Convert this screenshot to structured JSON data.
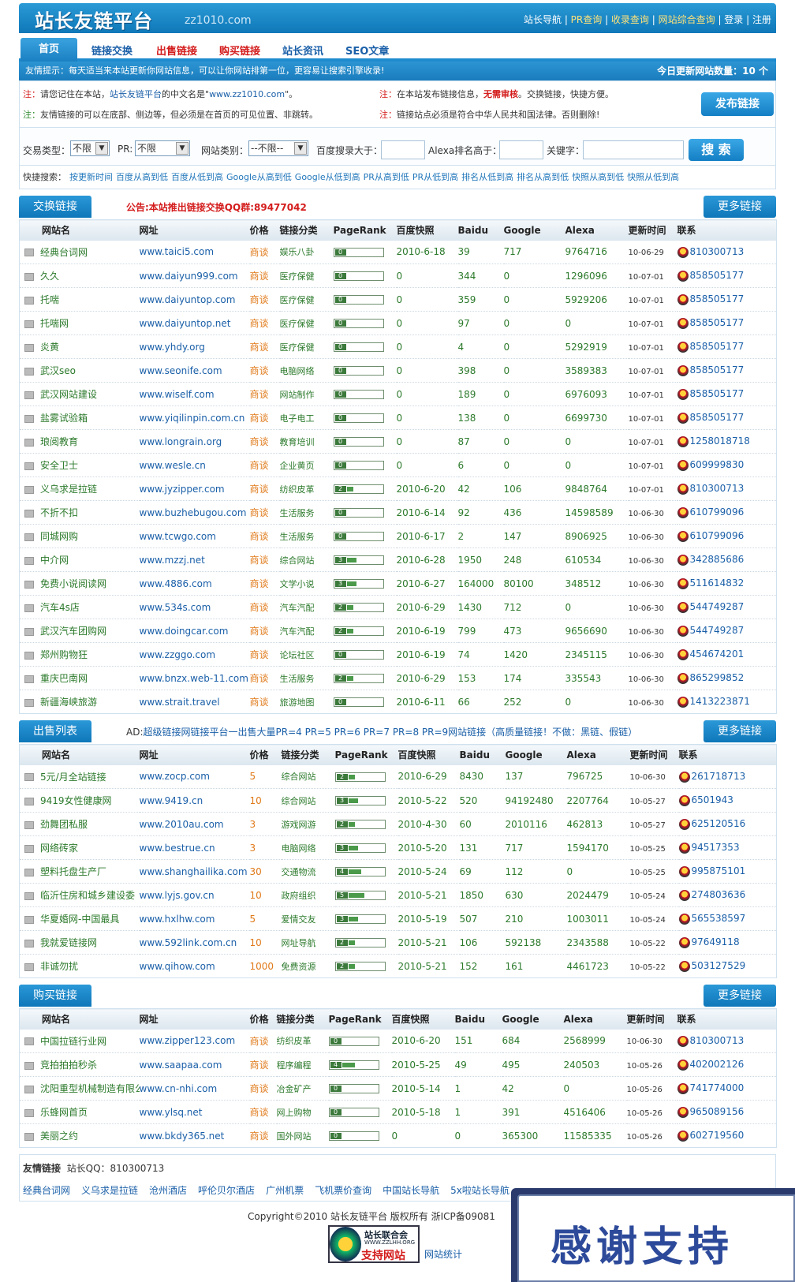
{
  "header": {
    "logo": "站长友链平台",
    "domain": "zz1010.com"
  },
  "toplinks": [
    "站长导航",
    "PR查询",
    "收录查询",
    "网站综合查询",
    "登录",
    "注册"
  ],
  "nav": [
    "首页",
    "链接交换",
    "出售链接",
    "购买链接",
    "站长资讯",
    "SEO文章"
  ],
  "tip": {
    "left": "友情提示：每天适当来本站更新你网站信息，可以让你网站排第一位，更容易让搜索引擎收录!",
    "right": "今日更新网站数量：10 个"
  },
  "notice": {
    "n1a": "注：",
    "n1b": "请您记住在本站，",
    "n1c": "站长友链平台",
    "n1d": "的中文名是\"",
    "n1e": "www.zz1010.com",
    "n1f": "\"。",
    "n2a": "注：",
    "n2b": "友情链接的可以在底部、侧边等，但必须是在首页的可见位置、非跳转。",
    "n3a": "注：",
    "n3b": "在本站发布链接信息，",
    "n3c": "无需审核",
    "n3d": "。交换链接，快捷方便。",
    "n4a": "注：",
    "n4b": "链接站点必须是符合中华人民共和国法律。否则删除!",
    "publish": "发布链接"
  },
  "search": {
    "type_label": "交易类型：",
    "type_val": "不限",
    "pr_label": "PR:",
    "pr_val": "不限",
    "cat_label": "网站类别：",
    "cat_val": "--不限--",
    "baidu_label": "百度搜录大于：",
    "alexa_label": "Alexa排名高于：",
    "kw_label": "关键字：",
    "btn": "搜 索"
  },
  "quick": {
    "label": "快捷搜索：",
    "links": [
      "按更新时间",
      "百度从高到低",
      "百度从低到高",
      "Google从高到低",
      "Google从低到高",
      "PR从高到低",
      "PR从低到高",
      "排名从低到高",
      "排名从高到低",
      "快照从高到低",
      "快照从低到高"
    ]
  },
  "cols": {
    "name": "网站名",
    "url": "网址",
    "price": "价格",
    "cat": "链接分类",
    "pr": "PageRank",
    "snap": "百度快照",
    "baidu": "Baidu",
    "google": "Google",
    "alexa": "Alexa",
    "time": "更新时间",
    "contact": "联系"
  },
  "exchange": {
    "title": "交换链接",
    "note": "公告:本站推出链接交换QQ群:89477042",
    "more": "更多链接",
    "rows": [
      {
        "name": "经典台词网",
        "url": "www.taici5.com",
        "price": "商谈",
        "cat": "娱乐八卦",
        "pr": "0",
        "snap": "2010-6-18",
        "baidu": "39",
        "google": "717",
        "alexa": "9764716",
        "time": "10-06-29",
        "qq": "810300713"
      },
      {
        "name": "久久",
        "url": "www.daiyun999.com",
        "price": "商谈",
        "cat": "医疗保健",
        "pr": "0",
        "snap": "0",
        "baidu": "344",
        "google": "0",
        "alexa": "1296096",
        "time": "10-07-01",
        "qq": "858505177"
      },
      {
        "name": "托喘",
        "url": "www.daiyuntop.com",
        "price": "商谈",
        "cat": "医疗保健",
        "pr": "0",
        "snap": "0",
        "baidu": "359",
        "google": "0",
        "alexa": "5929206",
        "time": "10-07-01",
        "qq": "858505177"
      },
      {
        "name": "托喘网",
        "url": "www.daiyuntop.net",
        "price": "商谈",
        "cat": "医疗保健",
        "pr": "0",
        "snap": "0",
        "baidu": "97",
        "google": "0",
        "alexa": "0",
        "time": "10-07-01",
        "qq": "858505177"
      },
      {
        "name": "炎黄",
        "url": "www.yhdy.org",
        "price": "商谈",
        "cat": "医疗保健",
        "pr": "0",
        "snap": "0",
        "baidu": "4",
        "google": "0",
        "alexa": "5292919",
        "time": "10-07-01",
        "qq": "858505177"
      },
      {
        "name": "武汉seo",
        "url": "www.seonife.com",
        "price": "商谈",
        "cat": "电脑网络",
        "pr": "0",
        "snap": "0",
        "baidu": "398",
        "google": "0",
        "alexa": "3589383",
        "time": "10-07-01",
        "qq": "858505177"
      },
      {
        "name": "武汉网站建设",
        "url": "www.wiself.com",
        "price": "商谈",
        "cat": "网站制作",
        "pr": "0",
        "snap": "0",
        "baidu": "189",
        "google": "0",
        "alexa": "6976093",
        "time": "10-07-01",
        "qq": "858505177"
      },
      {
        "name": "盐雾试验箱",
        "url": "www.yiqilinpin.com.cn",
        "price": "商谈",
        "cat": "电子电工",
        "pr": "0",
        "snap": "0",
        "baidu": "138",
        "google": "0",
        "alexa": "6699730",
        "time": "10-07-01",
        "qq": "858505177"
      },
      {
        "name": "琅阅教育",
        "url": "www.longrain.org",
        "price": "商谈",
        "cat": "教育培训",
        "pr": "0",
        "snap": "0",
        "baidu": "87",
        "google": "0",
        "alexa": "0",
        "time": "10-07-01",
        "qq": "1258018718"
      },
      {
        "name": "安全卫士",
        "url": "www.wesle.cn",
        "price": "商谈",
        "cat": "企业黄页",
        "pr": "0",
        "snap": "0",
        "baidu": "6",
        "google": "0",
        "alexa": "0",
        "time": "10-07-01",
        "qq": "609999830"
      },
      {
        "name": "义乌求是拉链",
        "url": "www.jyzipper.com",
        "price": "商谈",
        "cat": "纺织皮革",
        "pr": "2",
        "snap": "2010-6-20",
        "baidu": "42",
        "google": "106",
        "alexa": "9848764",
        "time": "10-07-01",
        "qq": "810300713"
      },
      {
        "name": "不折不扣",
        "url": "www.buzhebugou.com",
        "price": "商谈",
        "cat": "生活服务",
        "pr": "0",
        "snap": "2010-6-14",
        "baidu": "92",
        "google": "436",
        "alexa": "14598589",
        "time": "10-06-30",
        "qq": "610799096"
      },
      {
        "name": "同城网购",
        "url": "www.tcwgo.com",
        "price": "商谈",
        "cat": "生活服务",
        "pr": "0",
        "snap": "2010-6-17",
        "baidu": "2",
        "google": "147",
        "alexa": "8906925",
        "time": "10-06-30",
        "qq": "610799096"
      },
      {
        "name": "中介网",
        "url": "www.mzzj.net",
        "price": "商谈",
        "cat": "综合网站",
        "pr": "3",
        "snap": "2010-6-28",
        "baidu": "1950",
        "google": "248",
        "alexa": "610534",
        "time": "10-06-30",
        "qq": "342885686"
      },
      {
        "name": "免费小说阅读网",
        "url": "www.4886.com",
        "price": "商谈",
        "cat": "文学小说",
        "pr": "3",
        "snap": "2010-6-27",
        "baidu": "164000",
        "google": "80100",
        "alexa": "348512",
        "time": "10-06-30",
        "qq": "511614832"
      },
      {
        "name": "汽车4s店",
        "url": "www.534s.com",
        "price": "商谈",
        "cat": "汽车汽配",
        "pr": "2",
        "snap": "2010-6-29",
        "baidu": "1430",
        "google": "712",
        "alexa": "0",
        "time": "10-06-30",
        "qq": "544749287"
      },
      {
        "name": "武汉汽车团购网",
        "url": "www.doingcar.com",
        "price": "商谈",
        "cat": "汽车汽配",
        "pr": "2",
        "snap": "2010-6-19",
        "baidu": "799",
        "google": "473",
        "alexa": "9656690",
        "time": "10-06-30",
        "qq": "544749287"
      },
      {
        "name": "郑州购物狂",
        "url": "www.zzggo.com",
        "price": "商谈",
        "cat": "论坛社区",
        "pr": "0",
        "snap": "2010-6-19",
        "baidu": "74",
        "google": "1420",
        "alexa": "2345115",
        "time": "10-06-30",
        "qq": "454674201"
      },
      {
        "name": "重庆巴南网",
        "url": "www.bnzx.web-11.com",
        "price": "商谈",
        "cat": "生活服务",
        "pr": "2",
        "snap": "2010-6-29",
        "baidu": "153",
        "google": "174",
        "alexa": "335543",
        "time": "10-06-30",
        "qq": "865299852"
      },
      {
        "name": "新疆海峡旅游",
        "url": "www.strait.travel",
        "price": "商谈",
        "cat": "旅游地图",
        "pr": "0",
        "snap": "2010-6-11",
        "baidu": "66",
        "google": "252",
        "alexa": "0",
        "time": "10-06-30",
        "qq": "1413223871"
      }
    ]
  },
  "sale": {
    "title": "出售列表",
    "note_a": "AD:",
    "note_b": "超级链接网链接平台一出售大量PR=4 PR=5 PR=6 PR=7 PR=8 PR=9网站链接（高质量链接！不做：黑链、假链）",
    "more": "更多链接",
    "rows": [
      {
        "name": "5元/月全站链接",
        "url": "www.zocp.com",
        "price": "5",
        "cat": "综合网站",
        "pr": "2",
        "snap": "2010-6-29",
        "baidu": "8430",
        "google": "137",
        "alexa": "796725",
        "time": "10-06-30",
        "qq": "261718713"
      },
      {
        "name": "9419女性健康网",
        "url": "www.9419.cn",
        "price": "10",
        "cat": "综合网站",
        "pr": "3",
        "snap": "2010-5-22",
        "baidu": "520",
        "google": "94192480",
        "alexa": "2207764",
        "time": "10-05-27",
        "qq": "6501943"
      },
      {
        "name": "劲舞团私服",
        "url": "www.2010au.com",
        "price": "3",
        "cat": "游戏网游",
        "pr": "2",
        "snap": "2010-4-30",
        "baidu": "60",
        "google": "2010116",
        "alexa": "462813",
        "time": "10-05-27",
        "qq": "625120516"
      },
      {
        "name": "网络砖家",
        "url": "www.bestrue.cn",
        "price": "3",
        "cat": "电脑网络",
        "pr": "3",
        "snap": "2010-5-20",
        "baidu": "131",
        "google": "717",
        "alexa": "1594170",
        "time": "10-05-25",
        "qq": "94517353"
      },
      {
        "name": "塑料托盘生产厂",
        "url": "www.shanghailika.com",
        "price": "30",
        "cat": "交通物流",
        "pr": "4",
        "snap": "2010-5-24",
        "baidu": "69",
        "google": "112",
        "alexa": "0",
        "time": "10-05-25",
        "qq": "995875101"
      },
      {
        "name": "临沂住房和城乡建设委",
        "url": "www.lyjs.gov.cn",
        "price": "10",
        "cat": "政府组织",
        "pr": "5",
        "snap": "2010-5-21",
        "baidu": "1850",
        "google": "630",
        "alexa": "2024479",
        "time": "10-05-24",
        "qq": "274803636"
      },
      {
        "name": "华夏婚网-中国最具",
        "url": "www.hxlhw.com",
        "price": "5",
        "cat": "爱情交友",
        "pr": "3",
        "snap": "2010-5-19",
        "baidu": "507",
        "google": "210",
        "alexa": "1003011",
        "time": "10-05-24",
        "qq": "565538597"
      },
      {
        "name": "我就爱链接网",
        "url": "www.592link.com.cn",
        "price": "10",
        "cat": "网址导航",
        "pr": "2",
        "snap": "2010-5-21",
        "baidu": "106",
        "google": "592138",
        "alexa": "2343588",
        "time": "10-05-22",
        "qq": "97649118"
      },
      {
        "name": "非诚勿扰",
        "url": "www.qihow.com",
        "price": "1000",
        "cat": "免费资源",
        "pr": "2",
        "snap": "2010-5-21",
        "baidu": "152",
        "google": "161",
        "alexa": "4461723",
        "time": "10-05-22",
        "qq": "503127529"
      }
    ]
  },
  "buy": {
    "title": "购买链接",
    "more": "更多链接",
    "rows": [
      {
        "name": "中国拉链行业网",
        "url": "www.zipper123.com",
        "price": "商谈",
        "cat": "纺织皮革",
        "pr": "0",
        "snap": "2010-6-20",
        "baidu": "151",
        "google": "684",
        "alexa": "2568999",
        "time": "10-06-30",
        "qq": "810300713"
      },
      {
        "name": "竞拍拍拍秒杀",
        "url": "www.saapaa.com",
        "price": "商谈",
        "cat": "程序编程",
        "pr": "4",
        "snap": "2010-5-25",
        "baidu": "49",
        "google": "495",
        "alexa": "240503",
        "time": "10-05-26",
        "qq": "402002126"
      },
      {
        "name": "沈阳重型机械制造有限公司",
        "url": "www.cn-nhi.com",
        "price": "商谈",
        "cat": "冶金矿产",
        "pr": "0",
        "snap": "2010-5-14",
        "baidu": "1",
        "google": "42",
        "alexa": "0",
        "time": "10-05-26",
        "qq": "741774000"
      },
      {
        "name": "乐蜂网首页",
        "url": "www.ylsq.net",
        "price": "商谈",
        "cat": "网上购物",
        "pr": "0",
        "snap": "2010-5-18",
        "baidu": "1",
        "google": "391",
        "alexa": "4516406",
        "time": "10-05-26",
        "qq": "965089156"
      },
      {
        "name": "美丽之约",
        "url": "www.bkdy365.net",
        "price": "商谈",
        "cat": "国外网站",
        "pr": "0",
        "snap": "0",
        "baidu": "0",
        "google": "365300",
        "alexa": "11585335",
        "time": "10-05-26",
        "qq": "602719560"
      }
    ]
  },
  "friend": {
    "title": "友情链接",
    "qq": "站长QQ：810300713",
    "links": [
      "经典台词网",
      "义乌求是拉链",
      "沧州酒店",
      "呼伦贝尔酒店",
      "广州机票",
      "飞机票价查询",
      "中国站长导航",
      "5x啦站长导航"
    ]
  },
  "footer": {
    "copy": "Copyright©2010 站长友链平台 版权所有 浙ICP备09081",
    "badge_top": "站长联合会",
    "badge_mid": "WWW.ZZLHH.ORG",
    "badge_bot": "支持网站",
    "stat": "网站统计"
  },
  "overlay": {
    "text": "感谢支持"
  }
}
